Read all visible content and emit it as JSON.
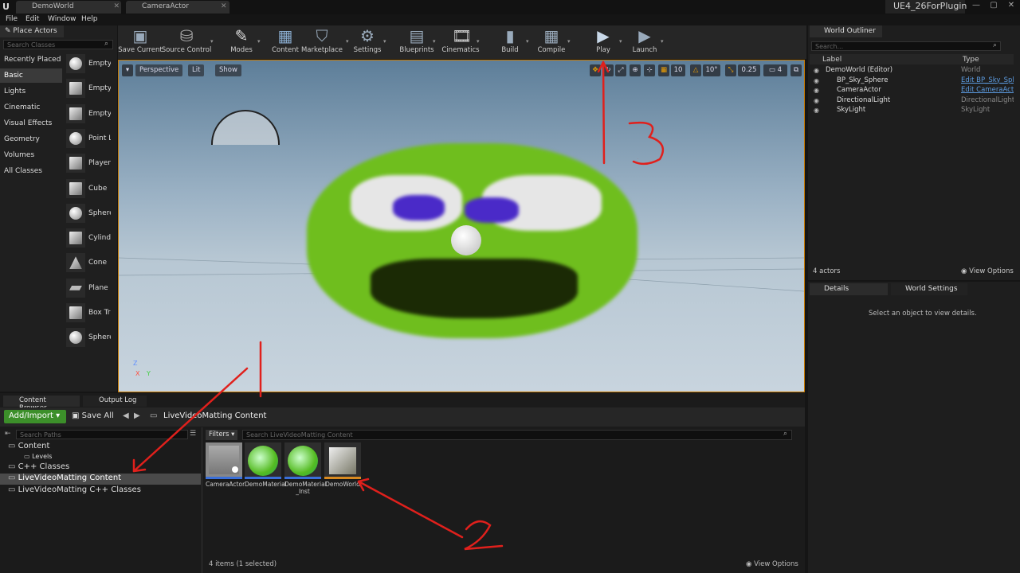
{
  "app": {
    "logo": "U",
    "project": "UE4_26ForPlugin",
    "tabs": [
      "DemoWorld",
      "CameraActor"
    ],
    "menu": [
      "File",
      "Edit",
      "Window",
      "Help"
    ]
  },
  "place_actors": {
    "title": "Place Actors",
    "search_placeholder": "Search Classes",
    "categories": [
      "Recently Placed",
      "Basic",
      "Lights",
      "Cinematic",
      "Visual Effects",
      "Geometry",
      "Volumes",
      "All Classes"
    ],
    "selected_category": "Basic",
    "items": [
      "Empty",
      "Empty",
      "Empty",
      "Point L",
      "Player",
      "Cube",
      "Sphere",
      "Cylinde",
      "Cone",
      "Plane",
      "Box Tr",
      "Sphere"
    ]
  },
  "toolbar": [
    "Save Current",
    "Source Control",
    "Modes",
    "Content",
    "Marketplace",
    "Settings",
    "Blueprints",
    "Cinematics",
    "Build",
    "Compile",
    "Play",
    "Launch"
  ],
  "viewport": {
    "perspective": "Perspective",
    "lit": "Lit",
    "show": "Show",
    "grid": "10",
    "rot": "10°",
    "scale": "0.25",
    "cam": "4",
    "axis_z": "Z",
    "axis_x": "X",
    "axis_y": "Y"
  },
  "outliner": {
    "title": "World Outliner",
    "search_placeholder": "Search...",
    "col_label": "Label",
    "col_type": "Type",
    "rows": [
      {
        "name": "DemoWorld (Editor)",
        "type": "World"
      },
      {
        "name": "BP_Sky_Sphere",
        "type": "Edit BP_Sky_Sphe"
      },
      {
        "name": "CameraActor",
        "type": "Edit CameraActor"
      },
      {
        "name": "DirectionalLight",
        "type": "DirectionalLight"
      },
      {
        "name": "SkyLight",
        "type": "SkyLight"
      }
    ],
    "count": "4 actors",
    "view_options": "View Options"
  },
  "details": {
    "tab1": "Details",
    "tab2": "World Settings",
    "empty": "Select an object to view details."
  },
  "content_browser": {
    "tab1": "Content Browser",
    "tab2": "Output Log",
    "add": "Add/Import",
    "save_all": "Save All",
    "path": "LiveVideoMatting Content",
    "paths_placeholder": "Search Paths",
    "tree": [
      "Content",
      "Levels",
      "C++ Classes",
      "LiveVideoMatting Content",
      "LiveVideoMatting C++ Classes"
    ],
    "filters": "Filters",
    "assets_placeholder": "Search LiveVideoMatting Content",
    "assets": [
      "CameraActor",
      "DemoMaterial",
      "DemoMaterial\n_Inst",
      "DemoWorld"
    ],
    "status": "4 items (1 selected)",
    "view_options": "View Options"
  },
  "annotations": [
    "1",
    "2",
    "3"
  ],
  "colors": {
    "accent_orange": "#c87a00",
    "add_green": "#3c8f2a",
    "link_blue": "#5c9be0",
    "annotation_red": "#e0201c"
  }
}
